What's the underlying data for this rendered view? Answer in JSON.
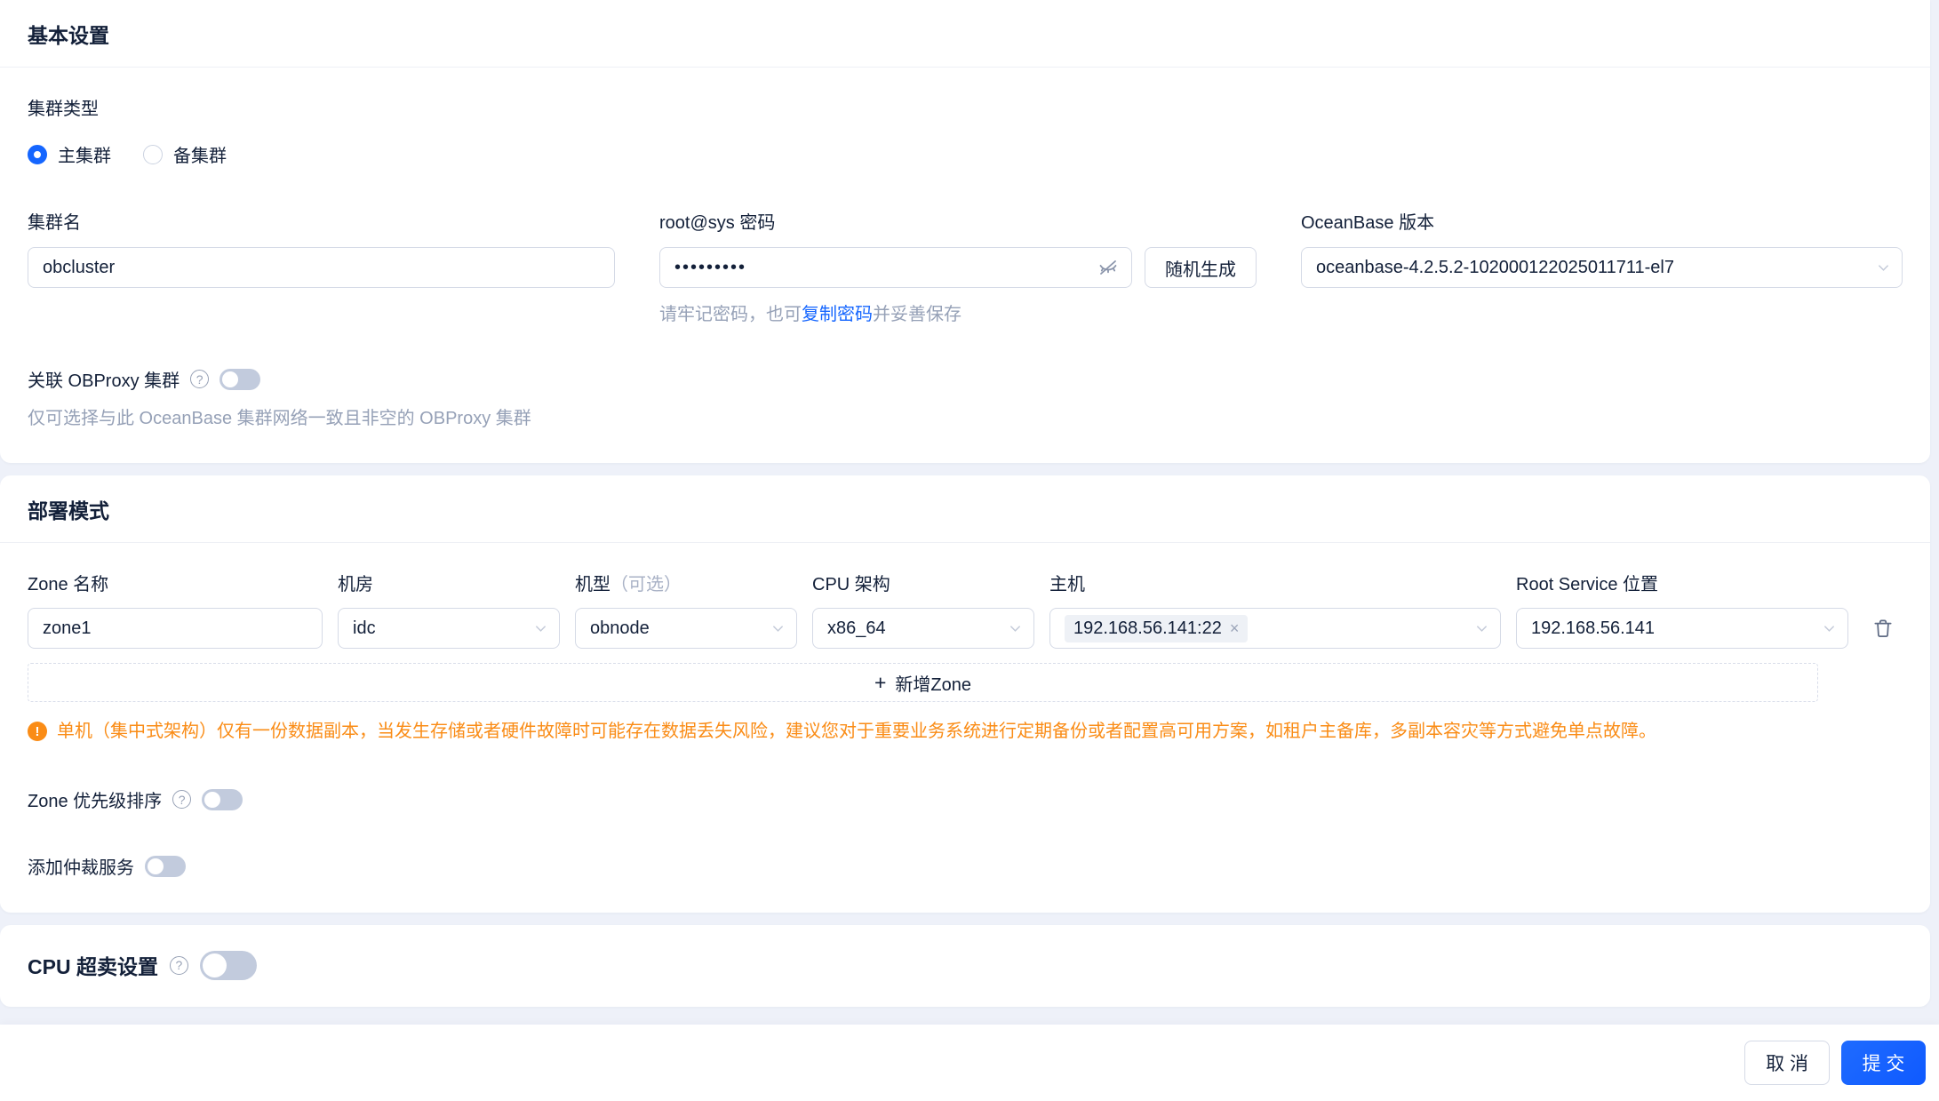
{
  "basic": {
    "title": "基本设置",
    "cluster_type": {
      "label": "集群类型",
      "options": [
        {
          "label": "主集群",
          "selected": true
        },
        {
          "label": "备集群",
          "selected": false
        }
      ]
    },
    "cluster_name": {
      "label": "集群名",
      "value": "obcluster"
    },
    "password": {
      "label": "root@sys 密码",
      "masked_value": "•••••••••",
      "random_button": "随机生成",
      "hint_prefix": "请牢记密码，也可",
      "hint_link": "复制密码",
      "hint_suffix": "并妥善保存"
    },
    "version": {
      "label": "OceanBase 版本",
      "value": "oceanbase-4.2.5.2-102000122025011711-el7"
    },
    "obproxy": {
      "label": "关联 OBProxy 集群",
      "toggle_on": false,
      "hint": "仅可选择与此 OceanBase 集群网络一致且非空的 OBProxy 集群"
    }
  },
  "deploy": {
    "title": "部署模式",
    "columns": {
      "zone_name": "Zone 名称",
      "idc": "机房",
      "machine": "机型",
      "machine_optional": "（可选）",
      "cpu_arch": "CPU 架构",
      "host": "主机",
      "root_service": "Root Service 位置"
    },
    "zone_row": {
      "zone_name": "zone1",
      "idc": "idc",
      "machine": "obnode",
      "cpu_arch": "x86_64",
      "host_tag": "192.168.56.141:22",
      "root_service": "192.168.56.141"
    },
    "add_zone_label": "新增Zone",
    "warning": "单机（集中式架构）仅有一份数据副本，当发生存储或者硬件故障时可能存在数据丢失风险，建议您对于重要业务系统进行定期备份或者配置高可用方案，如租户主备库，多副本容灾等方式避免单点故障。",
    "zone_priority": {
      "label": "Zone 优先级排序",
      "toggle_on": false
    },
    "arbitration": {
      "label": "添加仲裁服务",
      "toggle_on": false
    }
  },
  "cpu_oversell": {
    "label": "CPU 超卖设置",
    "toggle_on": false
  },
  "footer": {
    "cancel": "取 消",
    "submit": "提 交"
  },
  "icons": {
    "plus": "+",
    "close": "×",
    "question": "?",
    "warning": "!"
  },
  "colors": {
    "primary": "#1566ff",
    "warning": "#fa8c16",
    "page_background": "#eef1f9"
  }
}
